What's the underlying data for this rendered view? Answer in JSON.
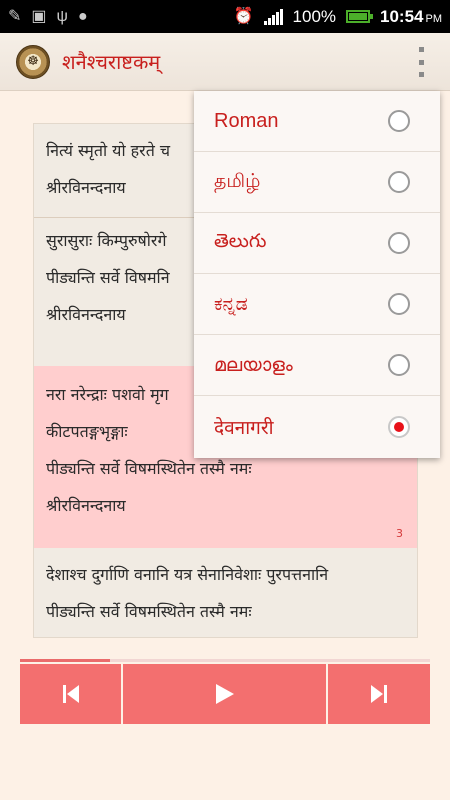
{
  "status_bar": {
    "battery_percent": "100%",
    "time": "10:54",
    "ampm": "PM"
  },
  "app": {
    "title": "शनैश्चराष्टकम्"
  },
  "verses": [
    {
      "lines": [
        "नित्यं स्मृतो यो हरते च",
        "श्रीरविनन्दनाय"
      ]
    },
    {
      "lines": [
        "सुरासुराः किम्पुरुषोरगे",
        "पीड्यन्ति सर्वे विषमनि",
        "श्रीरविनन्दनाय"
      ]
    },
    {
      "lines": [
        "नरा नरेन्द्राः पशवो मृग",
        "कीटपतङ्गभृङ्गाः",
        "पीड्यन्ति सर्वे विषमस्थितेन तस्मै नमः",
        "श्रीरविनन्दनाय"
      ],
      "number": "3",
      "highlighted": true
    },
    {
      "lines": [
        "देशाश्च दुर्गाणि वनानि यत्र सेनानिवेशाः पुरपत्तनानि",
        "पीड्यन्ति सर्वे विषमस्थितेन तस्मै नमः"
      ]
    }
  ],
  "script_menu": {
    "options": [
      {
        "label": "Roman",
        "selected": false
      },
      {
        "label": "தமிழ்",
        "selected": false
      },
      {
        "label": "తెలుగు",
        "selected": false
      },
      {
        "label": "ಕನ್ನಡ",
        "selected": false
      },
      {
        "label": "മലയാളം",
        "selected": false
      },
      {
        "label": "देवनागरी",
        "selected": true
      }
    ]
  },
  "player": {
    "progress": 0.22
  },
  "colors": {
    "accent": "#c8201e",
    "control_bg": "#f36f6f",
    "highlight_bg": "#ffcece"
  }
}
